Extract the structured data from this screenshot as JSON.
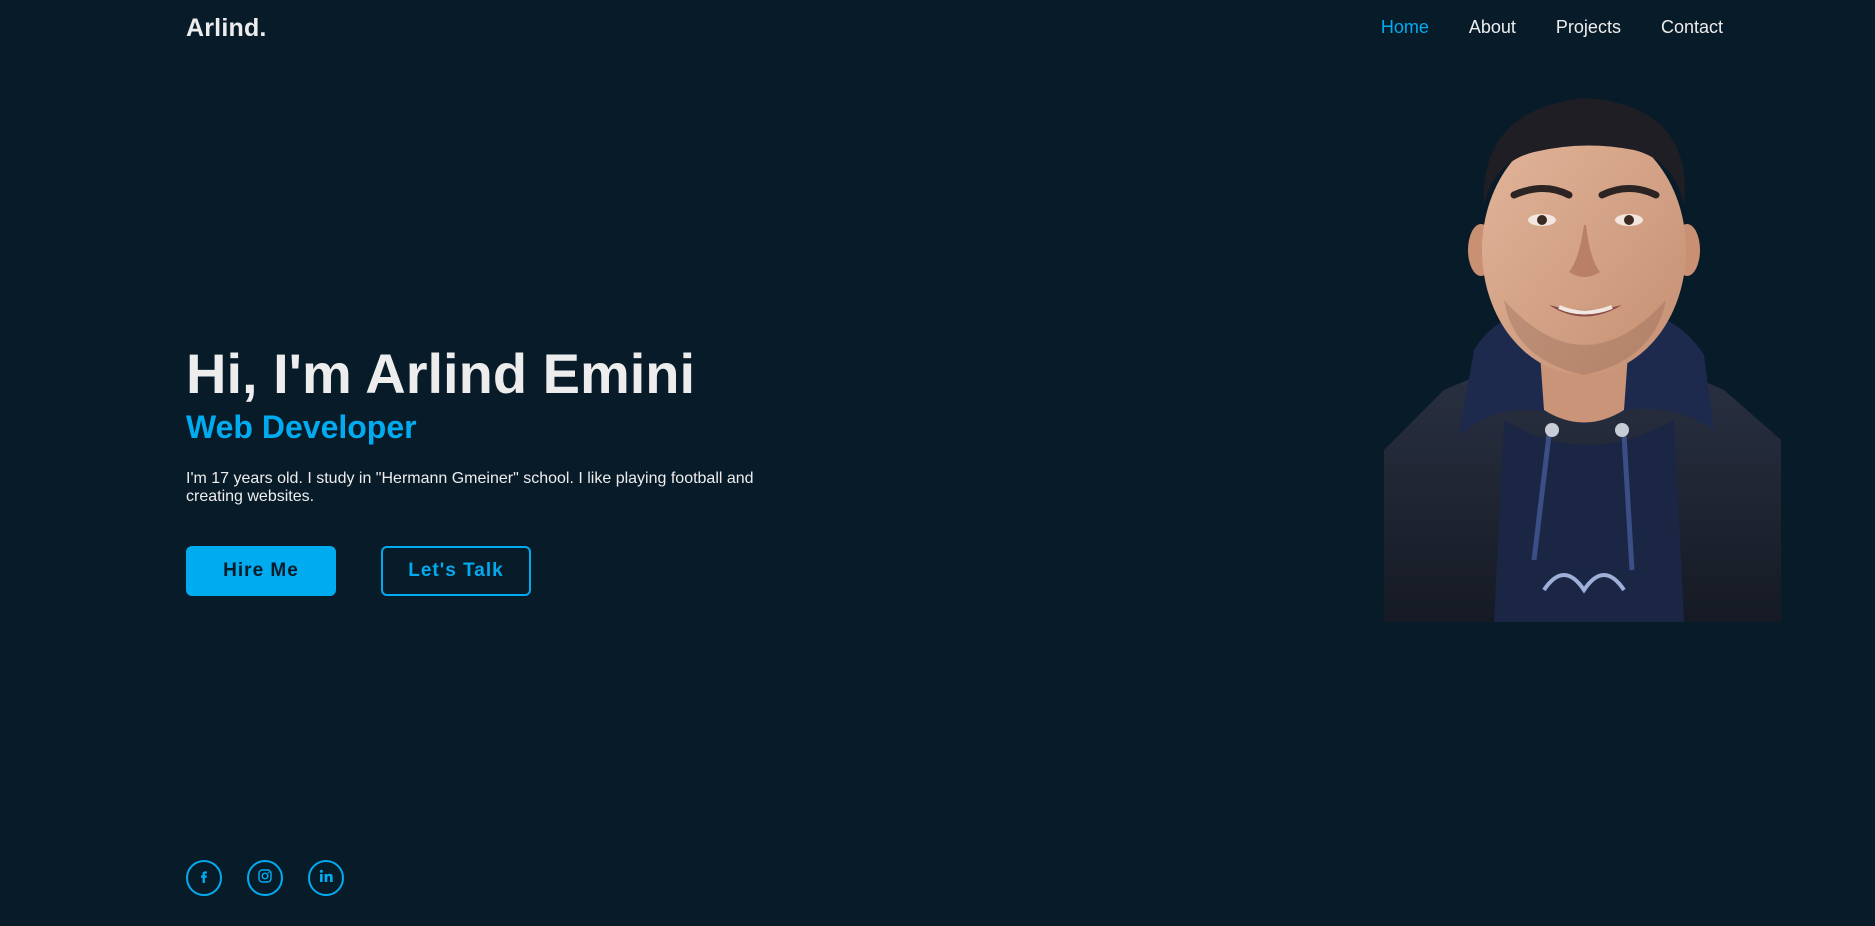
{
  "header": {
    "logo": "Arlind.",
    "nav": [
      {
        "label": "Home",
        "active": true
      },
      {
        "label": "About",
        "active": false
      },
      {
        "label": "Projects",
        "active": false
      },
      {
        "label": "Contact",
        "active": false
      }
    ]
  },
  "hero": {
    "title": "Hi, I'm Arlind Emini",
    "subtitle": "Web Developer",
    "description": "I'm 17 years old. I study in \"Hermann Gmeiner\" school. I like playing football and creating websites.",
    "buttons": {
      "hire": "Hire Me",
      "talk": "Let's Talk"
    }
  },
  "social": [
    {
      "icon": "facebook-icon"
    },
    {
      "icon": "instagram-icon"
    },
    {
      "icon": "linkedin-icon"
    }
  ],
  "colors": {
    "background": "#081b29",
    "accent": "#00abf0",
    "text": "#ededed"
  }
}
